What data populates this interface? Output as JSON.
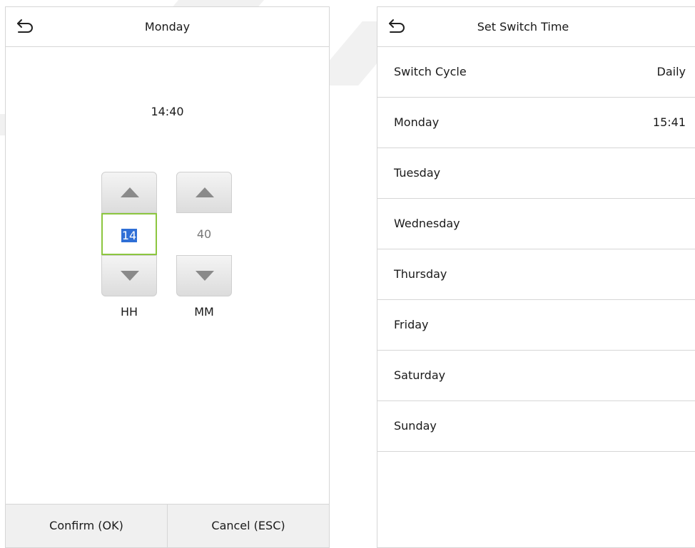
{
  "left": {
    "title": "Monday",
    "time_display": "14:40",
    "hour": {
      "value": "14",
      "label": "HH"
    },
    "minute": {
      "value": "40",
      "label": "MM"
    },
    "confirm_label": "Confirm (OK)",
    "cancel_label": "Cancel (ESC)"
  },
  "right": {
    "title": "Set Switch Time",
    "rows": [
      {
        "label": "Switch Cycle",
        "value": "Daily"
      },
      {
        "label": "Monday",
        "value": "15:41"
      },
      {
        "label": "Tuesday",
        "value": ""
      },
      {
        "label": "Wednesday",
        "value": ""
      },
      {
        "label": "Thursday",
        "value": ""
      },
      {
        "label": "Friday",
        "value": ""
      },
      {
        "label": "Saturday",
        "value": ""
      },
      {
        "label": "Sunday",
        "value": ""
      }
    ]
  },
  "colors": {
    "focus_border": "#8cc63f",
    "selection": "#2f6fd6",
    "divider": "#d6d6d6"
  },
  "icons": {
    "back": "back-arrow-icon",
    "up": "triangle-up-icon",
    "down": "triangle-down-icon"
  }
}
